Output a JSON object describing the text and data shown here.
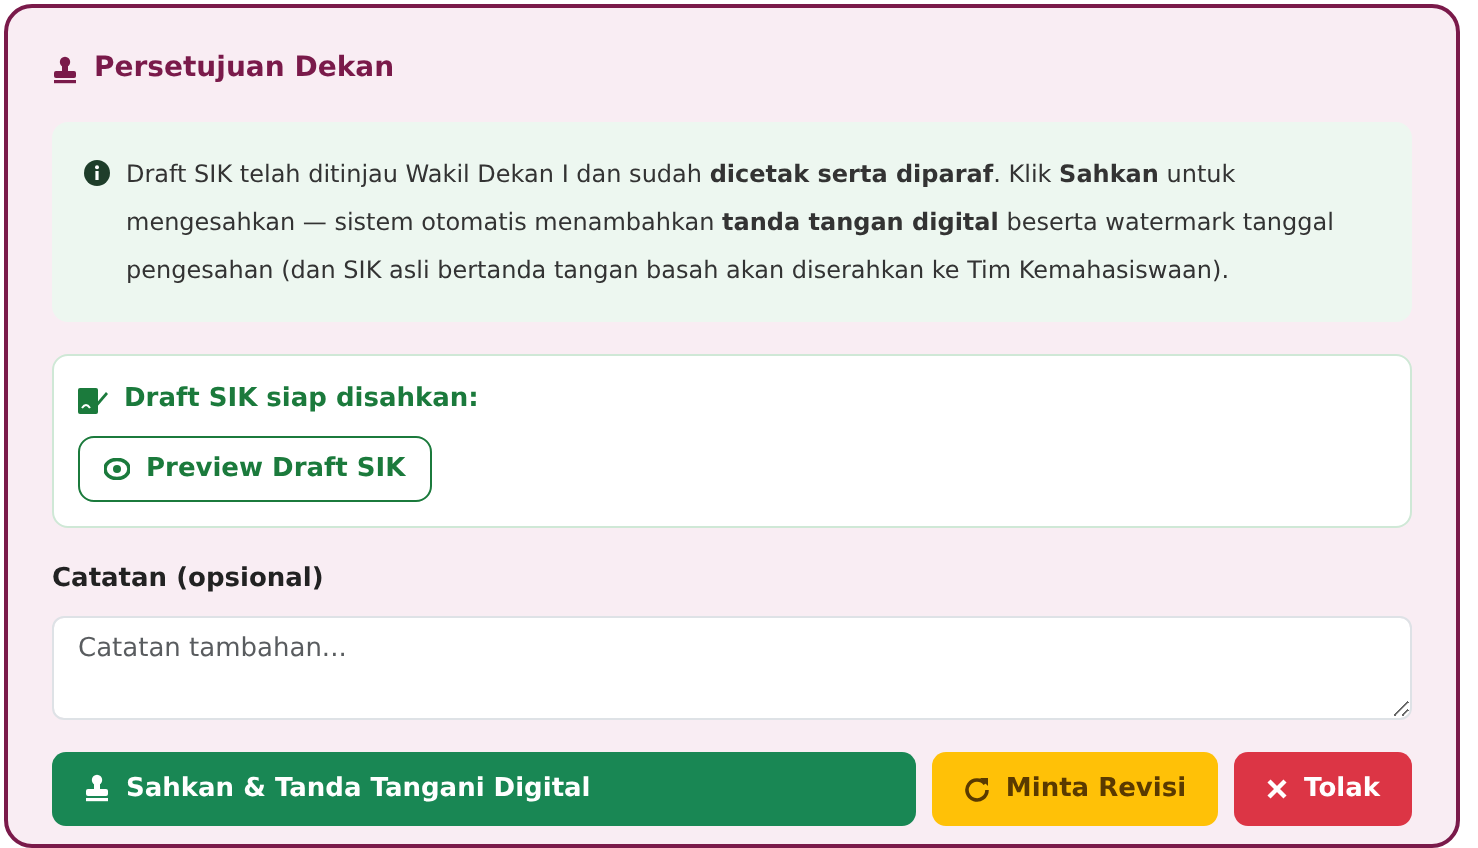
{
  "title": "Persetujuan Dekan",
  "info": "Draft SIK telah ditinjau Wakil Dekan I dan sudah **dicetak serta diparaf**. Klik **Sahkan** untuk mengesahkan — sistem otomatis menambahkan **tanda tangan digital** beserta watermark tanggal pengesahan (dan SIK asli bertanda tangan basah akan diserahkan ke Tim Kemahasiswaan).",
  "draft": {
    "heading": "Draft SIK siap disahkan:",
    "button": "Preview Draft SIK"
  },
  "note": {
    "label": "Catatan (opsional)",
    "placeholder": "Catatan tambahan..."
  },
  "actions": [
    {
      "kind": "approve",
      "label": "Sahkan & Tanda Tangani Digital"
    },
    {
      "kind": "revise",
      "label": "Minta Revisi"
    },
    {
      "kind": "reject",
      "label": "Tolak"
    }
  ]
}
